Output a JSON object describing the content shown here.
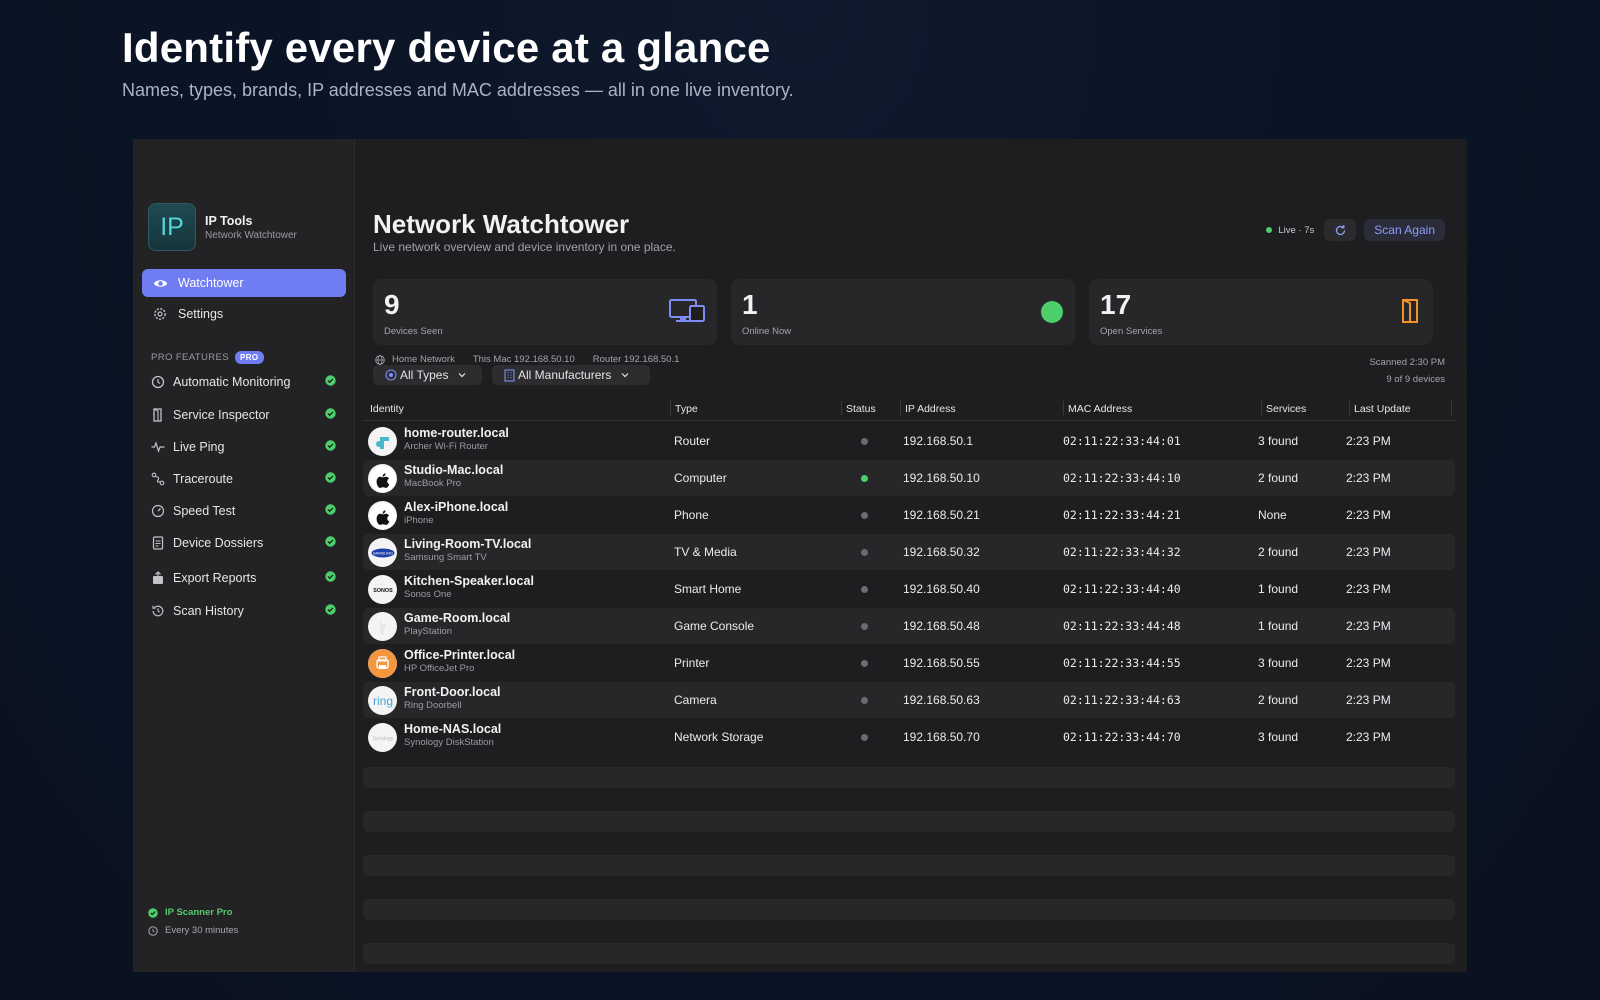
{
  "hero": {
    "title": "Identify every device at a glance",
    "subtitle": "Names, types, brands, IP addresses and MAC addresses — all in one live inventory."
  },
  "sidebar": {
    "app_logo_text": "IP",
    "app_name": "IP Tools",
    "app_subtitle": "Network Watchtower",
    "nav": [
      {
        "label": "Watchtower",
        "icon": "eye-icon",
        "active": true
      },
      {
        "label": "Settings",
        "icon": "gear-icon",
        "active": false
      }
    ],
    "pro_section_label": "PRO FEATURES",
    "pro_badge": "PRO",
    "pro_items": [
      {
        "label": "Automatic Monitoring",
        "icon": "monitor-clock-icon"
      },
      {
        "label": "Service Inspector",
        "icon": "door-icon"
      },
      {
        "label": "Live Ping",
        "icon": "pulse-icon"
      },
      {
        "label": "Traceroute",
        "icon": "route-icon"
      },
      {
        "label": "Speed Test",
        "icon": "gauge-icon"
      },
      {
        "label": "Device Dossiers",
        "icon": "document-icon"
      },
      {
        "label": "Export Reports",
        "icon": "export-icon"
      },
      {
        "label": "Scan History",
        "icon": "history-icon"
      }
    ],
    "footer_plan": "IP Scanner Pro",
    "footer_schedule": "Every 30 minutes"
  },
  "header": {
    "title": "Network Watchtower",
    "subtitle": "Live network overview and device inventory in one place.",
    "live_status": "Live · 7s",
    "scan_button": "Scan Again"
  },
  "stats": [
    {
      "value": "9",
      "label": "Devices Seen",
      "icon": "devices-icon"
    },
    {
      "value": "1",
      "label": "Online Now",
      "icon": "online-dot-icon"
    },
    {
      "value": "17",
      "label": "Open Services",
      "icon": "door-open-icon"
    }
  ],
  "network_info": {
    "network": "Home Network",
    "this_mac": "This Mac 192.168.50.10",
    "router": "Router 192.168.50.1",
    "scanned": "Scanned 2:30 PM",
    "count": "9 of 9 devices"
  },
  "filters": {
    "types": "All Types",
    "manufacturers": "All Manufacturers"
  },
  "table": {
    "columns": [
      "Identity",
      "Type",
      "Status",
      "IP Address",
      "MAC Address",
      "Services",
      "Last Update"
    ],
    "rows": [
      {
        "name": "home-router.local",
        "model": "Archer Wi-Fi Router",
        "type": "Router",
        "online": false,
        "ip": "192.168.50.1",
        "mac": "02:11:22:33:44:01",
        "services": "3 found",
        "updated": "2:23 PM",
        "logo": "tplink-logo-icon"
      },
      {
        "name": "Studio-Mac.local",
        "model": "MacBook Pro",
        "type": "Computer",
        "online": true,
        "ip": "192.168.50.10",
        "mac": "02:11:22:33:44:10",
        "services": "2 found",
        "updated": "2:23 PM",
        "logo": "apple-logo-icon"
      },
      {
        "name": "Alex-iPhone.local",
        "model": "iPhone",
        "type": "Phone",
        "online": false,
        "ip": "192.168.50.21",
        "mac": "02:11:22:33:44:21",
        "services": "None",
        "updated": "2:23 PM",
        "logo": "apple-logo-icon"
      },
      {
        "name": "Living-Room-TV.local",
        "model": "Samsung Smart TV",
        "type": "TV & Media",
        "online": false,
        "ip": "192.168.50.32",
        "mac": "02:11:22:33:44:32",
        "services": "2 found",
        "updated": "2:23 PM",
        "logo": "samsung-logo-icon"
      },
      {
        "name": "Kitchen-Speaker.local",
        "model": "Sonos One",
        "type": "Smart Home",
        "online": false,
        "ip": "192.168.50.40",
        "mac": "02:11:22:33:44:40",
        "services": "1 found",
        "updated": "2:23 PM",
        "logo": "sonos-logo-icon"
      },
      {
        "name": "Game-Room.local",
        "model": "PlayStation",
        "type": "Game Console",
        "online": false,
        "ip": "192.168.50.48",
        "mac": "02:11:22:33:44:48",
        "services": "1 found",
        "updated": "2:23 PM",
        "logo": "playstation-logo-icon"
      },
      {
        "name": "Office-Printer.local",
        "model": "HP OfficeJet Pro",
        "type": "Printer",
        "online": false,
        "ip": "192.168.50.55",
        "mac": "02:11:22:33:44:55",
        "services": "3 found",
        "updated": "2:23 PM",
        "logo": "printer-logo-icon"
      },
      {
        "name": "Front-Door.local",
        "model": "Ring Doorbell",
        "type": "Camera",
        "online": false,
        "ip": "192.168.50.63",
        "mac": "02:11:22:33:44:63",
        "services": "2 found",
        "updated": "2:23 PM",
        "logo": "ring-logo-icon"
      },
      {
        "name": "Home-NAS.local",
        "model": "Synology DiskStation",
        "type": "Network Storage",
        "online": false,
        "ip": "192.168.50.70",
        "mac": "02:11:22:33:44:70",
        "services": "3 found",
        "updated": "2:23 PM",
        "logo": "synology-logo-icon"
      }
    ]
  },
  "colors": {
    "accent": "#6f7cf2",
    "online": "#4ccf6a",
    "offline": "#6c6c70",
    "scan_button_text": "#8f9cff",
    "services_icon": "#f0932b"
  }
}
